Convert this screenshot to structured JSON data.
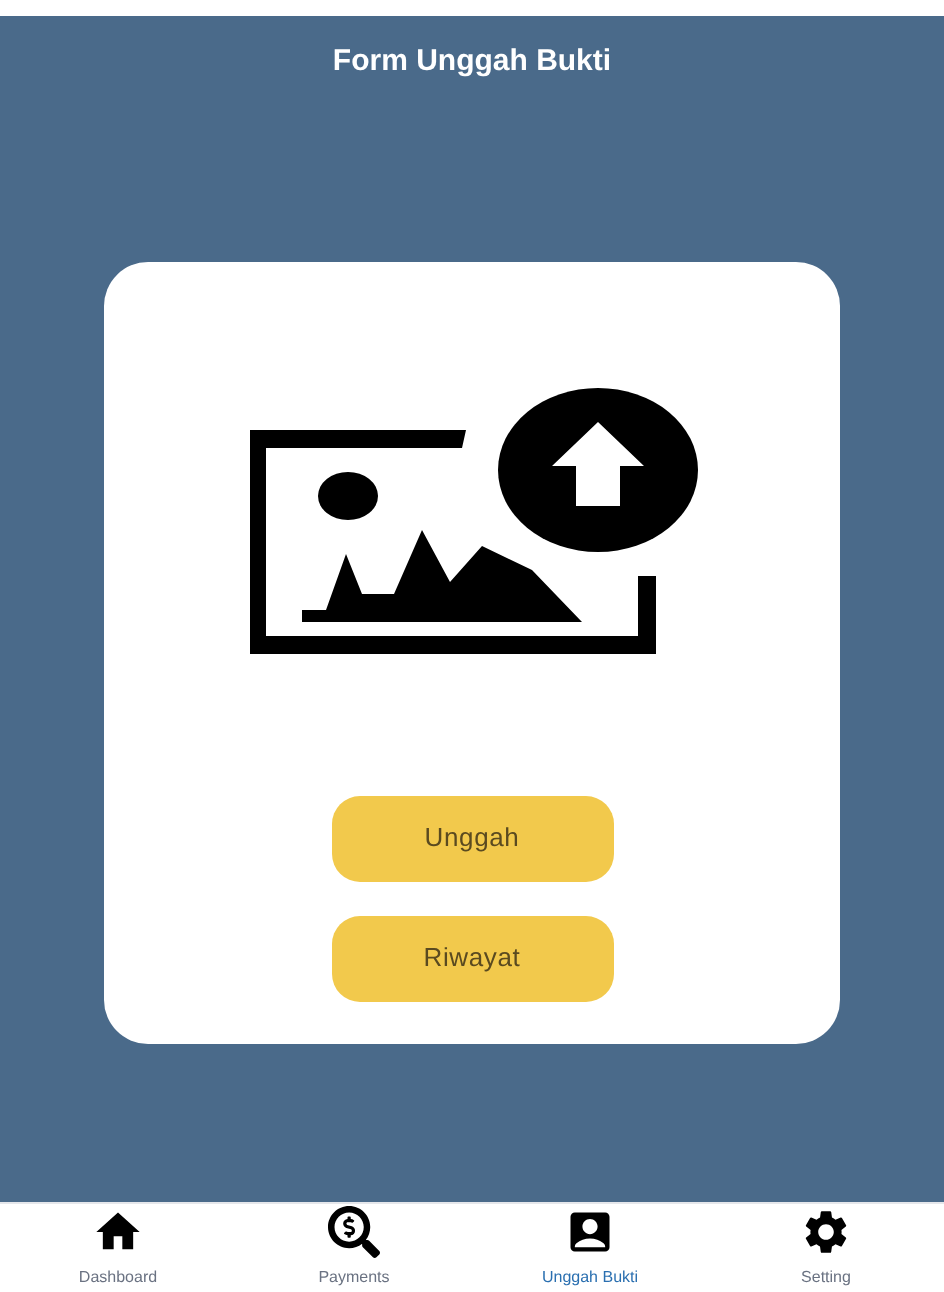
{
  "header": {
    "title": "Form Unggah Bukti"
  },
  "card": {
    "buttons": [
      "Unggah",
      "Riwayat"
    ]
  },
  "nav": [
    {
      "label": "Dashboard",
      "selected": false
    },
    {
      "label": "Payments",
      "selected": false
    },
    {
      "label": "Unggah Bukti",
      "selected": true
    },
    {
      "label": "Setting",
      "selected": false
    }
  ]
}
